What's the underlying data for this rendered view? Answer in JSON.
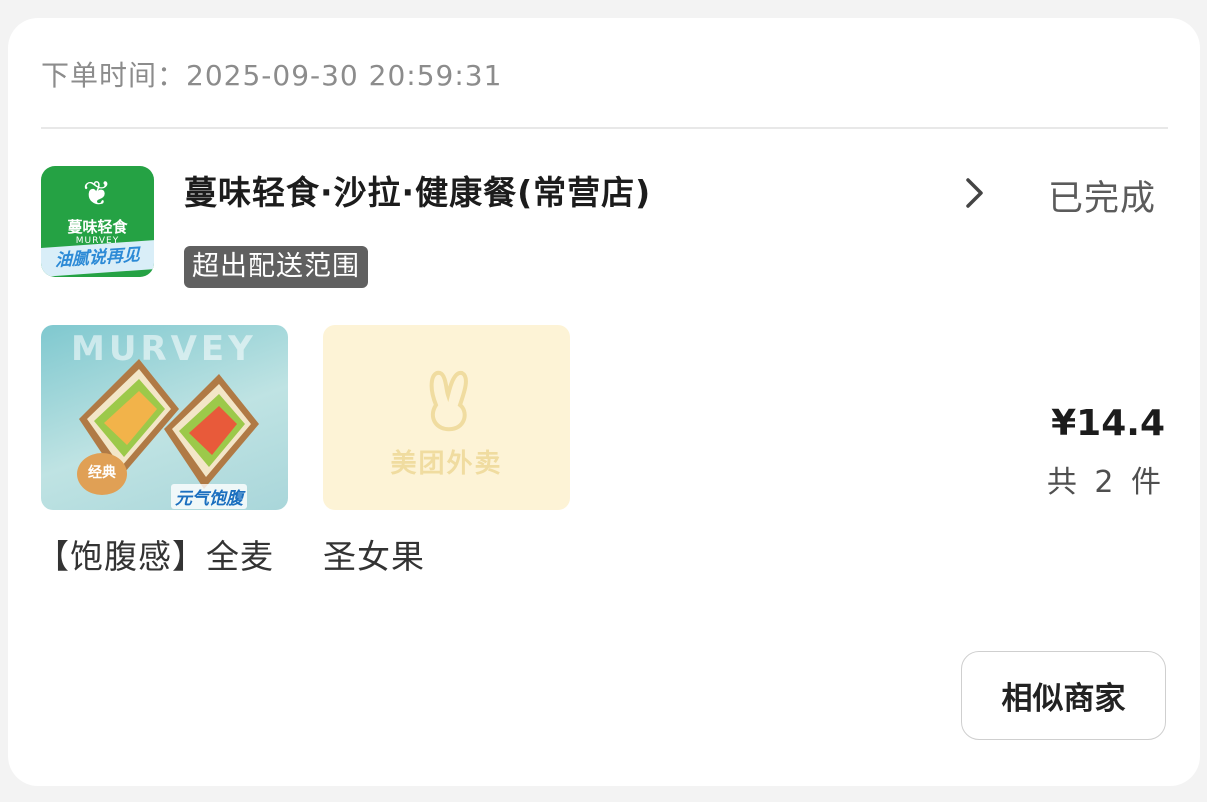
{
  "order": {
    "time_label": "下单时间：",
    "time_value": "2025-09-30 20:59:31",
    "status": "已完成"
  },
  "store": {
    "name": "蔓味轻食·沙拉·健康餐(常营店)",
    "tag": "超出配送范围",
    "logo": {
      "brand_cn": "蔓味轻食",
      "brand_en": "MURVEY",
      "banner": "油腻说再见"
    }
  },
  "products": [
    {
      "name": "【饱腹感】全麦",
      "image_watermark": "MURVEY",
      "image_badge": "经典",
      "image_slogan": "元气饱腹"
    },
    {
      "name": "圣女果",
      "image_placeholder": "美团外卖"
    }
  ],
  "summary": {
    "price": "¥14.4",
    "count": "共 2 件"
  },
  "actions": {
    "similar_label": "相似商家"
  },
  "colors": {
    "logo_green": "#25a244",
    "tag_bg": "#606060",
    "placeholder_bg": "#fdf3d6"
  }
}
